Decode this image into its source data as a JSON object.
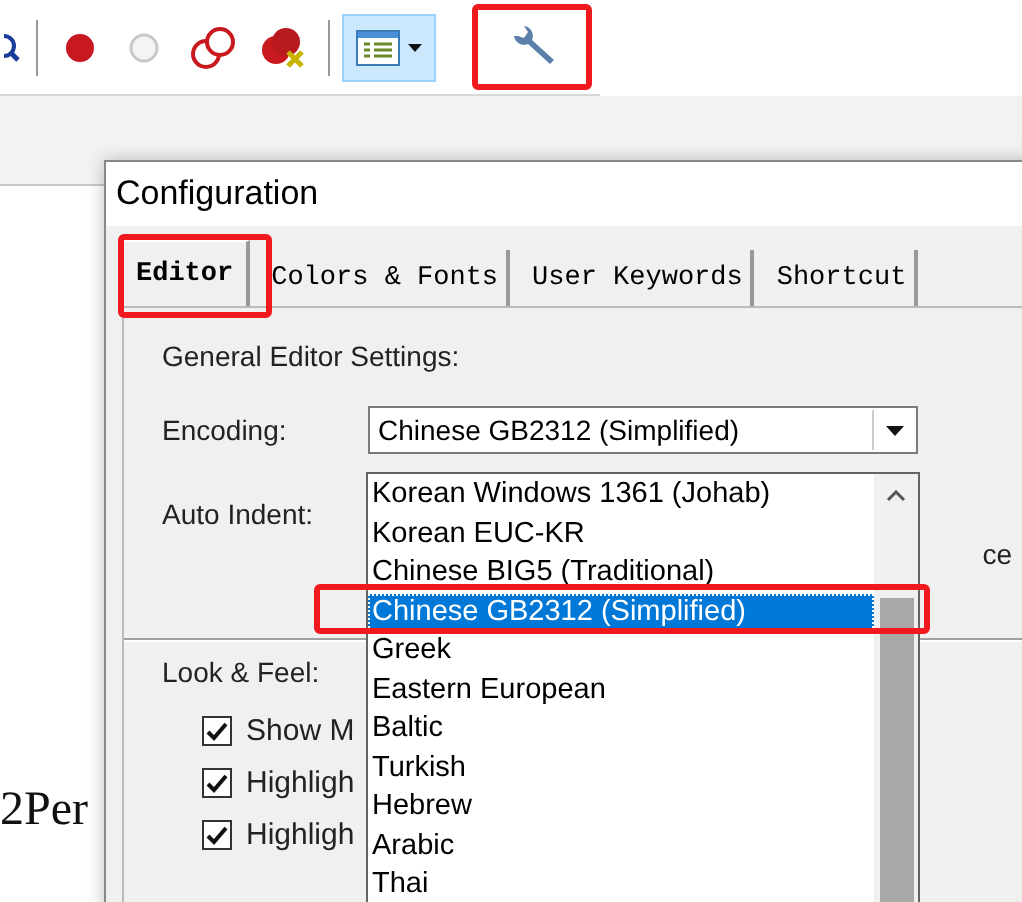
{
  "editor_text": "2Per",
  "dialog": {
    "title": "Configuration",
    "tabs": [
      {
        "label": "Editor",
        "selected": true
      },
      {
        "label": "Colors & Fonts",
        "selected": false
      },
      {
        "label": "User Keywords",
        "selected": false
      },
      {
        "label": "Shortcut",
        "selected": false
      }
    ],
    "general_heading": "General Editor Settings:",
    "encoding": {
      "label": "Encoding:",
      "value": "Chinese GB2312 (Simplified)"
    },
    "auto_indent": {
      "label": "Auto Indent:"
    },
    "partial_option_text": "ce",
    "look_and_feel": {
      "heading": "Look & Feel:",
      "options": [
        {
          "label": "Show M",
          "checked": true
        },
        {
          "label": "Highligh",
          "checked": true
        },
        {
          "label": "Highligh",
          "checked": true
        }
      ]
    }
  },
  "encoding_list": {
    "items": [
      {
        "label": "Korean Windows 1361 (Johab)",
        "selected": false
      },
      {
        "label": "Korean EUC-KR",
        "selected": false
      },
      {
        "label": "Chinese BIG5 (Traditional)",
        "selected": false
      },
      {
        "label": "Chinese GB2312 (Simplified)",
        "selected": true
      },
      {
        "label": "Greek",
        "selected": false
      },
      {
        "label": "Eastern European",
        "selected": false
      },
      {
        "label": "Baltic",
        "selected": false
      },
      {
        "label": "Turkish",
        "selected": false
      },
      {
        "label": "Hebrew",
        "selected": false
      },
      {
        "label": "Arabic",
        "selected": false
      },
      {
        "label": "Thai",
        "selected": false
      }
    ]
  }
}
